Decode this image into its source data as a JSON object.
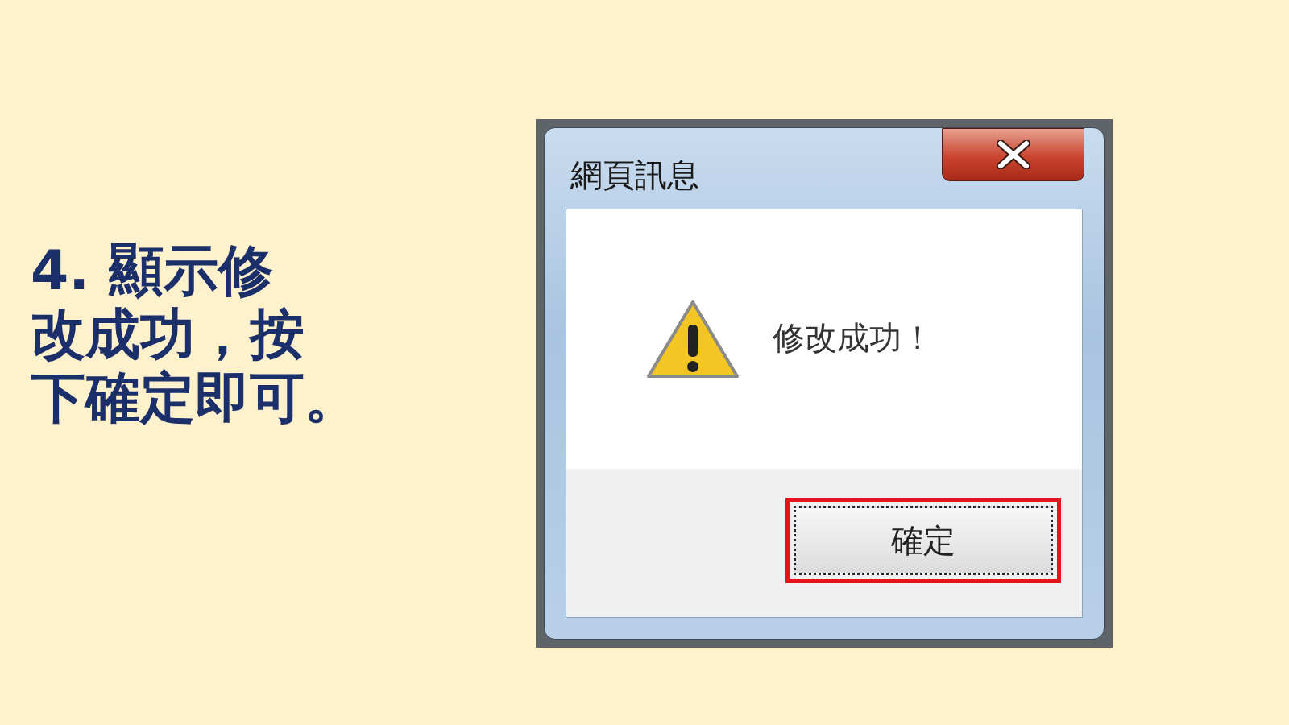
{
  "slide": {
    "instruction_lines": [
      "4. 顯示修",
      "改成功，按",
      "下確定即可。"
    ]
  },
  "dialog": {
    "title": "網頁訊息",
    "message": "修改成功！",
    "buttons": [
      {
        "label": "確定",
        "highlighted": true
      }
    ]
  }
}
